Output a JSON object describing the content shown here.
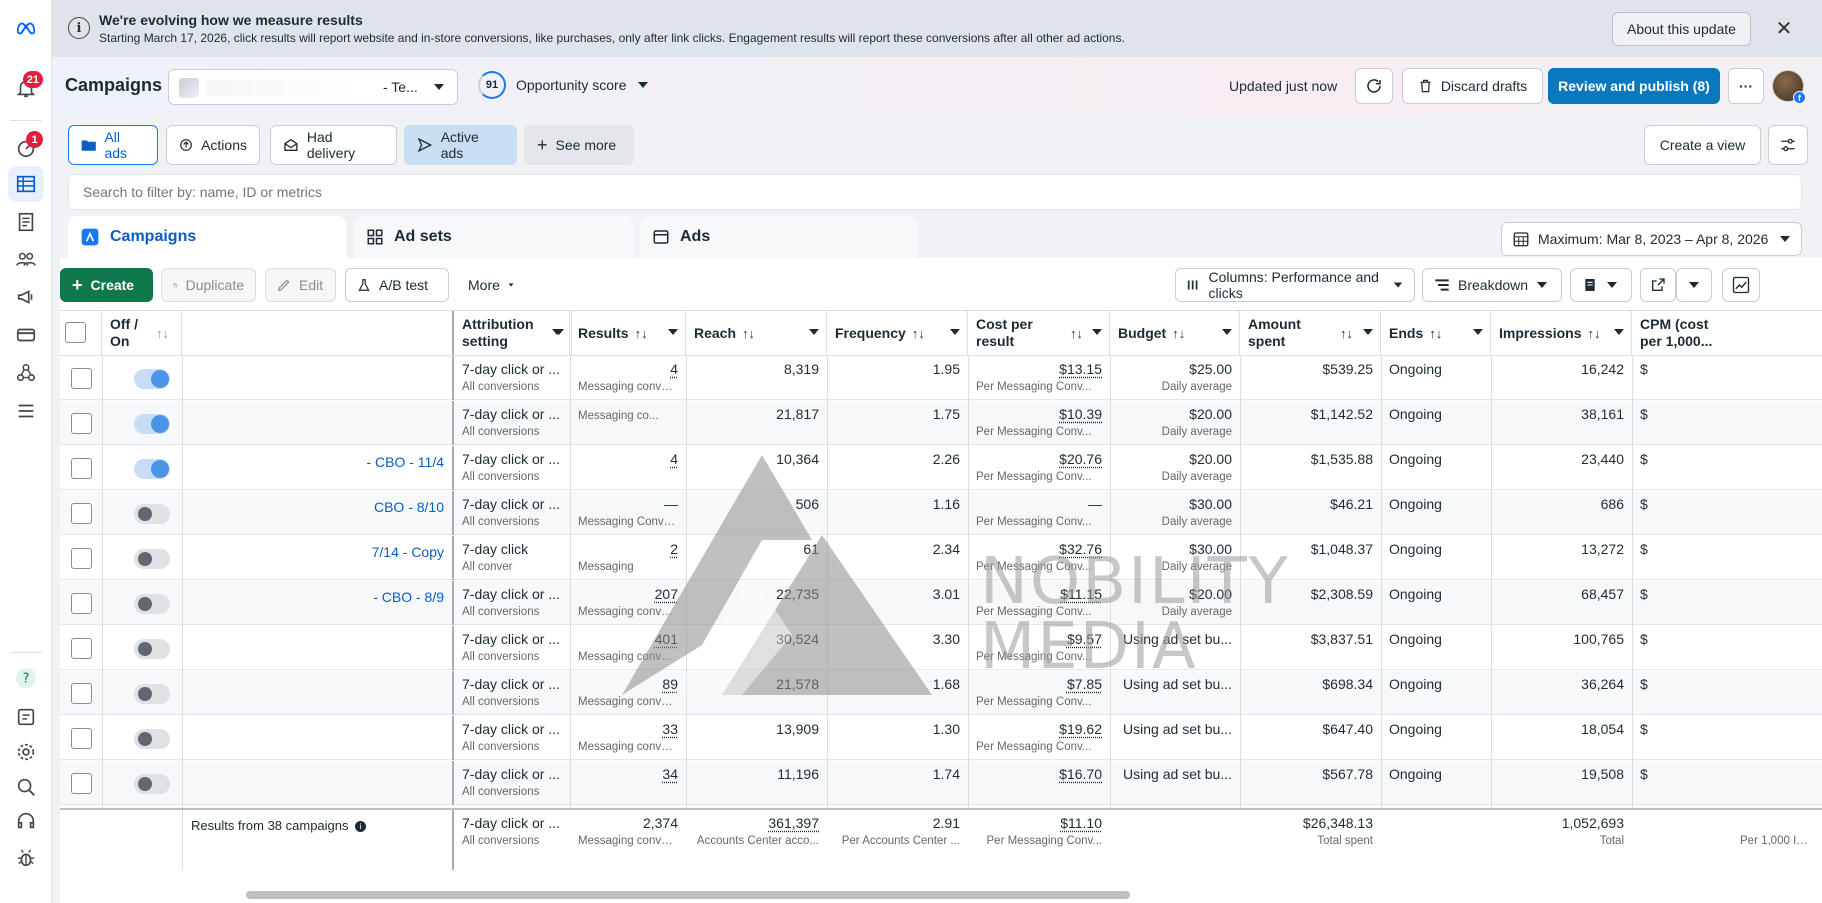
{
  "rail": {
    "notifications_badge": "21",
    "alerts_badge": "1"
  },
  "banner": {
    "title": "We're evolving how we measure results",
    "body": "Starting March 17, 2026, click results will report website and in-store conversions, like purchases, only after link clicks. Engagement results will report these conversions after all other ad actions.",
    "about_label": "About this update",
    "info_glyph": "i",
    "close_glyph": "✕"
  },
  "header": {
    "title": "Campaigns",
    "account_suffix": "- Te...",
    "opportunity_value": "91",
    "opportunity_label": "Opportunity score",
    "updated": "Updated just now",
    "discard_label": "Discard drafts",
    "review_label": "Review and publish (8)",
    "more_glyph": "···"
  },
  "views": {
    "all_ads": "All ads",
    "actions": "Actions",
    "had_delivery": "Had delivery",
    "active_ads": "Active ads",
    "see_more": "See more",
    "create_view": "Create a view"
  },
  "search": {
    "placeholder": "Search to filter by: name, ID or metrics"
  },
  "tabs": {
    "campaigns": "Campaigns",
    "ad_sets": "Ad sets",
    "ads": "Ads"
  },
  "date_range": "Maximum: Mar 8, 2023 – Apr 8, 2026",
  "toolbar": {
    "create": "Create",
    "duplicate": "Duplicate",
    "edit": "Edit",
    "ab_test": "A/B test",
    "more": "More",
    "columns": "Columns: Performance and clicks",
    "breakdown": "Breakdown"
  },
  "columns": {
    "off_on": "Off / On",
    "attribution": "Attribution setting",
    "results": "Results",
    "reach": "Reach",
    "frequency": "Frequency",
    "cost_per_result": "Cost per result",
    "budget": "Budget",
    "amount_spent": "Amount spent",
    "ends": "Ends",
    "impressions": "Impressions",
    "cpm": "CPM (cost per 1,000..."
  },
  "rows": [
    {
      "on": true,
      "name": "",
      "attr": "7-day click or ...",
      "attr_sub": "All conversions",
      "results": "4",
      "results_sub": "Messaging convers...",
      "reach": "8,319",
      "frequency": "1.95",
      "cpr": "$13.15",
      "cpr_sub": "Per Messaging Conv...",
      "budget": "$25.00",
      "budget_sub": "Daily average",
      "spent": "$539.25",
      "ends": "Ongoing",
      "impressions": "16,242",
      "cpm": "$"
    },
    {
      "on": true,
      "name": "",
      "attr": "7-day click or ...",
      "attr_sub": "All conversions",
      "results": "",
      "results_sub": "Messaging co...",
      "reach": "21,817",
      "frequency": "1.75",
      "cpr": "$10.39",
      "cpr_sub": "Per Messaging Conv...",
      "budget": "$20.00",
      "budget_sub": "Daily average",
      "spent": "$1,142.52",
      "ends": "Ongoing",
      "impressions": "38,161",
      "cpm": "$"
    },
    {
      "on": true,
      "name": "- CBO - 11/4",
      "attr": "7-day click or ...",
      "attr_sub": "All conversions",
      "results": "4",
      "results_sub": "",
      "reach": "10,364",
      "frequency": "2.26",
      "cpr": "$20.76",
      "cpr_sub": "Per Messaging Conv...",
      "budget": "$20.00",
      "budget_sub": "Daily average",
      "spent": "$1,535.88",
      "ends": "Ongoing",
      "impressions": "23,440",
      "cpm": "$"
    },
    {
      "on": false,
      "name": "CBO - 8/10",
      "attr": "7-day click or ...",
      "attr_sub": "All conversions",
      "results": "—",
      "results_sub": "Messaging Conversat...",
      "reach": "506",
      "frequency": "1.16",
      "cpr": "—",
      "cpr_sub": "Per Messaging Conv...",
      "budget": "$30.00",
      "budget_sub": "Daily average",
      "spent": "$46.21",
      "ends": "Ongoing",
      "impressions": "686",
      "cpm": "$"
    },
    {
      "on": false,
      "name": "7/14 - Copy",
      "attr": "7-day click",
      "attr_sub": "All conver",
      "results": "2",
      "results_sub": "Messaging",
      "reach": "61",
      "frequency": "2.34",
      "cpr": "$32.76",
      "cpr_sub": "Per Messaging Conv...",
      "budget": "$30.00",
      "budget_sub": "Daily average",
      "spent": "$1,048.37",
      "ends": "Ongoing",
      "impressions": "13,272",
      "cpm": "$"
    },
    {
      "on": false,
      "name": "- CBO - 8/9",
      "attr": "7-day click or ...",
      "attr_sub": "All conversions",
      "results": "207",
      "results_sub": "Messaging conversat...",
      "reach": "22,735",
      "frequency": "3.01",
      "cpr": "$11.15",
      "cpr_sub": "Per Messaging Conv...",
      "budget": "$20.00",
      "budget_sub": "Daily average",
      "spent": "$2,308.59",
      "ends": "Ongoing",
      "impressions": "68,457",
      "cpm": "$"
    },
    {
      "on": false,
      "name": "",
      "attr": "7-day click or ...",
      "attr_sub": "All conversions",
      "results": "401",
      "results_sub": "Messaging conversat...",
      "reach": "30,524",
      "frequency": "3.30",
      "cpr": "$9.57",
      "cpr_sub": "Per Messaging Conv...",
      "budget": "Using ad set bu...",
      "budget_sub": "",
      "spent": "$3,837.51",
      "ends": "Ongoing",
      "impressions": "100,765",
      "cpm": "$"
    },
    {
      "on": false,
      "name": "",
      "attr": "7-day click or ...",
      "attr_sub": "All conversions",
      "results": "89",
      "results_sub": "Messaging conversat...",
      "reach": "21,578",
      "frequency": "1.68",
      "cpr": "$7.85",
      "cpr_sub": "Per Messaging Conv...",
      "budget": "Using ad set bu...",
      "budget_sub": "",
      "spent": "$698.34",
      "ends": "Ongoing",
      "impressions": "36,264",
      "cpm": "$"
    },
    {
      "on": false,
      "name": "",
      "attr": "7-day click or ...",
      "attr_sub": "All conversions",
      "results": "33",
      "results_sub": "Messaging conversat...",
      "reach": "13,909",
      "frequency": "1.30",
      "cpr": "$19.62",
      "cpr_sub": "Per Messaging Conv...",
      "budget": "Using ad set bu...",
      "budget_sub": "",
      "spent": "$647.40",
      "ends": "Ongoing",
      "impressions": "18,054",
      "cpm": "$"
    },
    {
      "on": false,
      "name": "",
      "attr": "7-day click or ...",
      "attr_sub": "All conversions",
      "results": "34",
      "results_sub": "",
      "reach": "11,196",
      "frequency": "1.74",
      "cpr": "$16.70",
      "cpr_sub": "",
      "budget": "Using ad set bu...",
      "budget_sub": "",
      "spent": "$567.78",
      "ends": "Ongoing",
      "impressions": "19,508",
      "cpm": "$"
    }
  ],
  "totals": {
    "label": "Results from 38 campaigns",
    "attr": "7-day click or ...",
    "attr_sub": "All conversions",
    "results": "2,374",
    "results_sub": "Messaging conversat...",
    "reach": "361,397",
    "reach_sub": "Accounts Center acco...",
    "frequency": "2.91",
    "frequency_sub": "Per Accounts Center ...",
    "cpr": "$11.10",
    "cpr_sub": "Per Messaging Conv...",
    "spent": "$26,348.13",
    "spent_sub": "Total spent",
    "impressions": "1,052,693",
    "impressions_sub": "Total",
    "cpm_sub": "Per 1,000 Impr"
  },
  "watermark": {
    "line1": "NOBILITY",
    "line2": "MEDIA"
  },
  "colors": {
    "accent": "#0a78be",
    "create_green": "#11784c",
    "badge_red": "#e41e3f"
  }
}
